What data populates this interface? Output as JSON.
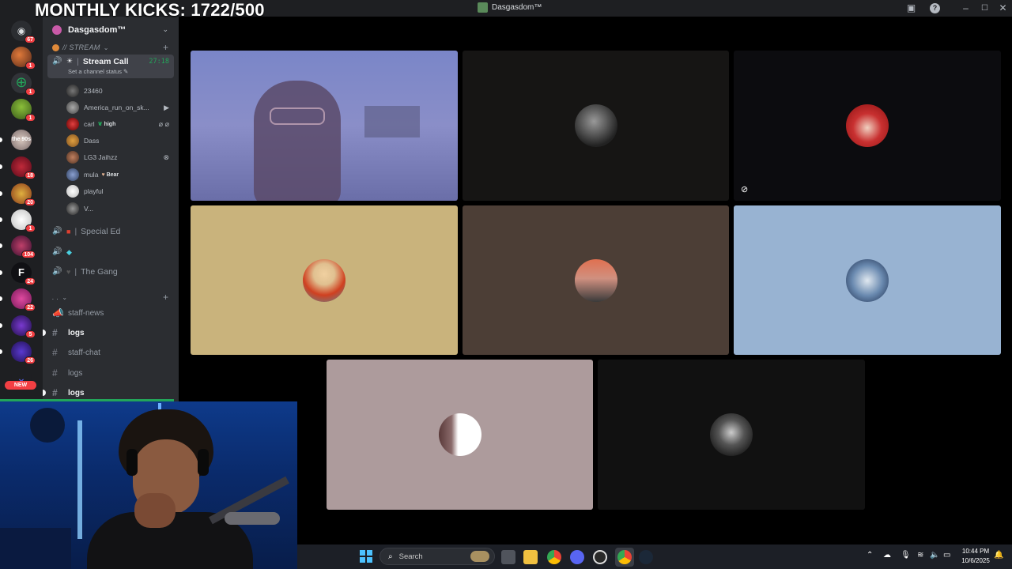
{
  "overlay": {
    "title": "MONTHLY KICKS: 1722/500"
  },
  "window": {
    "title": "Dasgasdom™"
  },
  "rail": {
    "badges": [
      "67",
      "1",
      "1",
      "1",
      "18",
      "20",
      "1",
      "104",
      "24",
      "22",
      "5",
      "26"
    ],
    "new_label": "NEW"
  },
  "sidebar": {
    "server_name": "Dasgasdom™",
    "category_stream": "// STREAM",
    "active_channel": {
      "name": "Stream Call",
      "timer": "27:18",
      "status_placeholder": "Set a channel status"
    },
    "members": [
      {
        "name": "23460"
      },
      {
        "name": "America_run_on_sk..."
      },
      {
        "name": "carl",
        "tag": "high"
      },
      {
        "name": "Dass"
      },
      {
        "name": "LG3 Jaihzz"
      },
      {
        "name": "mula",
        "tag": "Bear"
      },
      {
        "name": "playful"
      },
      {
        "name": "V..."
      }
    ],
    "voice_channels": [
      {
        "name": "Special Ed"
      },
      {
        "name": ""
      },
      {
        "name": "The Gang"
      }
    ],
    "category_second": ". .",
    "text_channels": [
      {
        "name": "staff-news"
      },
      {
        "name": "logs"
      },
      {
        "name": "staff-chat"
      },
      {
        "name": "logs"
      },
      {
        "name": "logs"
      }
    ]
  },
  "taskbar": {
    "search_placeholder": "Search",
    "time": "10:44 PM",
    "date": "10/6/2025"
  },
  "colors": {
    "accent_green": "#23a55a",
    "badge_red": "#f23f43",
    "sidebar_bg": "#2b2d31",
    "rail_bg": "#1e1f22"
  },
  "icons": [
    "discord-home-icon",
    "add-server-icon",
    "speaker-icon",
    "hash-icon",
    "camera-icon",
    "mute-icon",
    "xbox-icon",
    "windows-start-icon",
    "search-icon",
    "wifi-icon",
    "volume-icon",
    "battery-icon"
  ]
}
